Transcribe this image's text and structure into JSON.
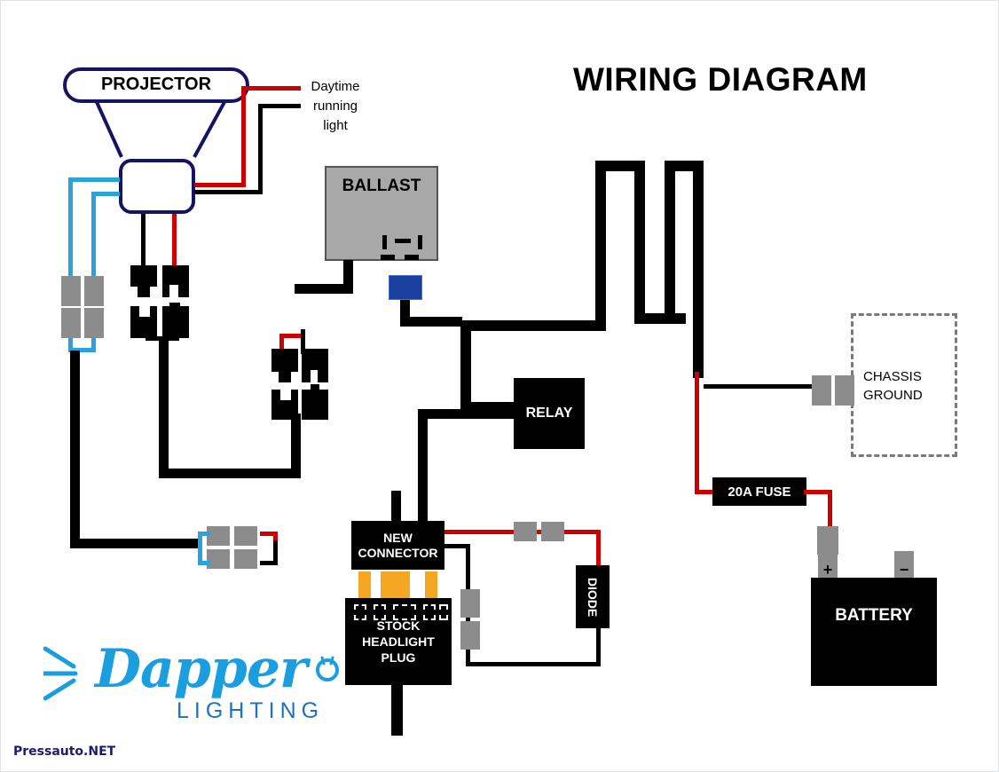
{
  "page": {
    "title": "WIRING DIAGRAM",
    "watermark": "Pressauto.NET",
    "background_color": "#ffffff"
  },
  "brand": {
    "name": "Dapper",
    "subtitle": "LIGHTING",
    "logo_color": "#1b9ee0",
    "subtitle_color": "#1b72c4"
  },
  "components": {
    "projector": {
      "label": "PROJECTOR",
      "outline_color": "#141463"
    },
    "daytime_running_light": {
      "line1": "Daytime",
      "line2": "running",
      "line3": "light"
    },
    "ballast": {
      "label": "BALLAST",
      "fill_color": "#a8a8a8"
    },
    "blue_connector": {
      "label": "",
      "color": "#1b3f9e"
    },
    "relay": {
      "label": "RELAY",
      "fill_color": "#000000",
      "text_color": "#ffffff"
    },
    "fuse": {
      "label": "20A FUSE",
      "rating": "20A"
    },
    "new_connector": {
      "line1": "NEW",
      "line2": "CONNECTOR"
    },
    "stock_headlight_plug": {
      "line1": "STOCK",
      "line2": "HEADLIGHT",
      "line3": "PLUG"
    },
    "diode": {
      "label": "DIODE"
    },
    "battery": {
      "label": "BATTERY",
      "positive_terminal": "+",
      "negative_terminal": "−"
    },
    "chassis_ground": {
      "line1": "CHASSIS",
      "line2": "GROUND",
      "border_style": "dashed"
    }
  },
  "wire_colors": {
    "power_positive": "#cc0000",
    "ground_negative": "#000000",
    "low_beam": "#29a3dc",
    "housing_outline": "#141463",
    "connector_pad": "#8c8c8c",
    "pin": "#f5a623"
  }
}
